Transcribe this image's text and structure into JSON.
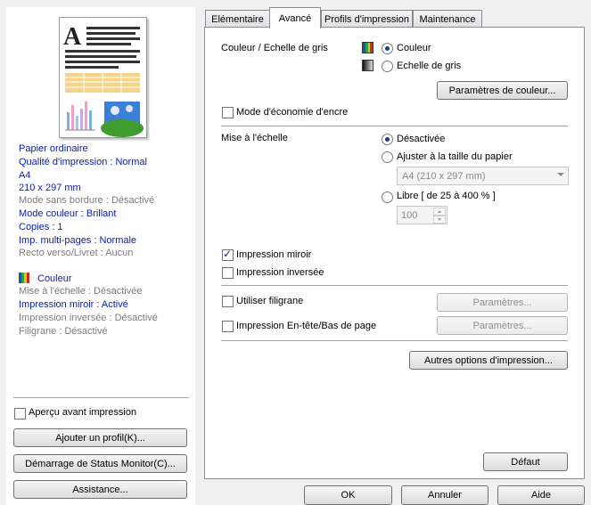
{
  "tabs": [
    {
      "label": "Elémentaire"
    },
    {
      "label": "Avancé"
    },
    {
      "label": "Profils d'impression"
    },
    {
      "label": "Maintenance"
    }
  ],
  "summary": {
    "lines1": [
      "Papier ordinaire",
      "Qualité d'impression : Normal",
      "A4",
      "210 x 297 mm",
      "Mode sans bordure : Désactivé",
      "Mode couleur : Brillant",
      "Copies : 1",
      "Imp. multi-pages : Normale",
      "Recto verso/Livret : Aucun"
    ],
    "color_label": "Couleur",
    "lines2": [
      "Mise à l'échelle : Désactivée",
      "Impression miroir : Activé",
      "Impression inversée : Désactivé",
      "Filigrane : Désactivé"
    ]
  },
  "left": {
    "preview_checkbox": "Aperçu avant impression",
    "add_profile": "Ajouter un profil(K)...",
    "status_monitor": "Démarrage de Status Monitor(C)...",
    "assistance": "Assistance..."
  },
  "advanced": {
    "color_group_label": "Couleur / Echelle de gris",
    "color_option": "Couleur",
    "grayscale_option": "Echelle de gris",
    "color_settings_button": "Paramètres de couleur...",
    "ink_saving": "Mode d'économie d'encre",
    "scaling_label": "Mise à l'échelle",
    "scaling_off": "Désactivée",
    "scaling_fit": "Ajuster à la taille du papier",
    "paper_select": "A4 (210 x 297 mm)",
    "scaling_free": "Libre [ de 25 à 400 % ]",
    "scaling_value": "100",
    "mirror_print": "Impression miroir",
    "reverse_print": "Impression inversée",
    "watermark": "Utiliser filigrane",
    "watermark_settings": "Paramètres...",
    "header_footer": "Impression En-tête/Bas de page",
    "header_footer_settings": "Paramètres...",
    "other_options": "Autres options d'impression...",
    "default_button": "Défaut"
  },
  "dialog": {
    "ok": "OK",
    "cancel": "Annuler",
    "help": "Aide"
  },
  "colors": {
    "summary_blue": "#0a1ea8",
    "summary_gray": "#7c7c7c"
  }
}
